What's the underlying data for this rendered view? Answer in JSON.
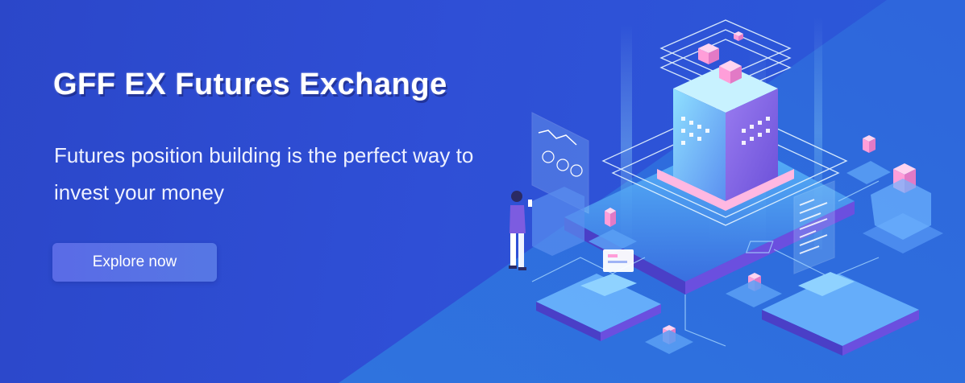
{
  "banner": {
    "title": "GFF EX Futures Exchange",
    "subtitle": "Futures position building is the perfect way to invest your money",
    "cta_label": "Explore now"
  },
  "colors": {
    "background": "#2f4fd6",
    "accent_light": "#3a8ee8",
    "button": "#5a6be6",
    "cube_pink": "#ff9ed9",
    "glow_cyan": "#7fe3ff"
  },
  "illustration": {
    "subject": "isometric-data-center",
    "icons": [
      "server-tower",
      "data-cube",
      "person-with-phone",
      "desk-workstation",
      "chart-panel",
      "code-panel"
    ]
  }
}
